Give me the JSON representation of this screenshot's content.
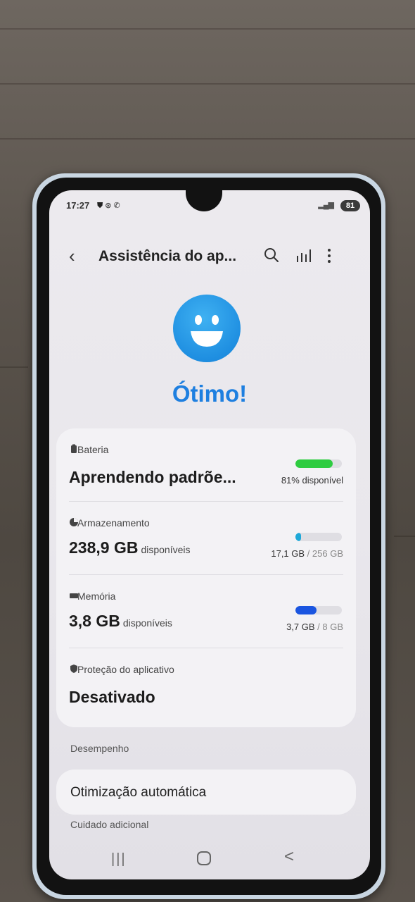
{
  "status_bar": {
    "time": "17:27",
    "battery": "81",
    "icons": [
      "shield-icon",
      "sync-icon",
      "phone-icon",
      "signal-icon"
    ]
  },
  "appbar": {
    "title": "Assistência do ap...",
    "actions": [
      "back-icon",
      "search-icon",
      "stats-icon",
      "more-icon"
    ]
  },
  "hero": {
    "status": "Ótimo!",
    "face_color": "#1f8fe1"
  },
  "items": {
    "battery": {
      "label": "Bateria",
      "value": "Aprendendo padrõe...",
      "meta": "81% disponível",
      "level": 0.81,
      "bar_color": "#2ecc40"
    },
    "storage": {
      "label": "Armazenamento",
      "value": "238,9 GB",
      "suffix": "disponíveis",
      "used": "17,1 GB",
      "separator": " / ",
      "total": "256 GB",
      "level": 0.067,
      "bar_color": "#1ea8d8"
    },
    "memory": {
      "label": "Memória",
      "value": "3,8 GB",
      "suffix": "disponíveis",
      "used": "3,7 GB",
      "separator": " / ",
      "total": "8 GB",
      "level": 0.46,
      "bar_color": "#1a55e0"
    },
    "app_protection": {
      "label": "Proteção do aplicativo",
      "value": "Desativado"
    }
  },
  "performance": {
    "header": "Desempenho",
    "item": "Otimização automática"
  },
  "extra_care": {
    "header": "Cuidado adicional"
  },
  "navbar": {
    "recent": "|||",
    "back": "<"
  }
}
